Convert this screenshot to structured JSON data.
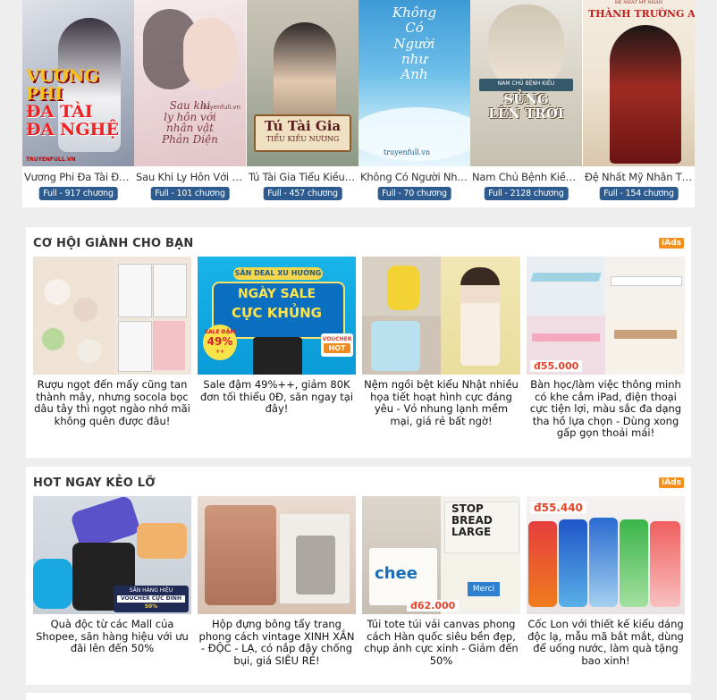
{
  "books": [
    {
      "title": "Vương Phi Đa Tài Đa Nghệ",
      "status": "Full - 917 chương",
      "cover_lines": [
        "VƯƠNG PHI",
        "ĐA TÀI",
        "ĐA NGHỆ"
      ],
      "cover_site": "TRUYENFULL.VN"
    },
    {
      "title": "Sau Khi Ly Hôn Với Nhân Vật Phản Diện",
      "status": "Full - 101 chương",
      "cover_lines": [
        "Sau khi",
        "ly hôn với",
        "nhân vật",
        "Phản Diện"
      ],
      "cover_site": "truyenfull.vn"
    },
    {
      "title": "Tú Tài Gia Tiểu Kiều Nương",
      "status": "Full - 457 chương",
      "cover_lines": [
        "Tú Tài Gia"
      ],
      "cover_sub": "TIỂU KIỀU NƯƠNG"
    },
    {
      "title": "Không Có Người Như Anh",
      "status": "Full - 70 chương",
      "cover_lines": [
        "Không",
        "Có",
        "Người",
        "như",
        "Anh"
      ],
      "cover_site": "truyenfull.vn"
    },
    {
      "title": "Nam Chủ Bệnh Kiều, Sủng Lên Trời",
      "status": "Full - 2128 chương",
      "cover_lines": [
        "SỦNG",
        "LÊN TRỜI"
      ],
      "cover_sub": "NAM CHỦ BỆNH KIỀU"
    },
    {
      "title": "Đệ Nhất Mỹ Nhân Thành Trường An",
      "status": "Full - 154 chương",
      "cover_lines": [
        "THÀNH TRƯỜNG AN"
      ],
      "cover_sub": "ĐỆ NHẤT MỸ NHÂN"
    }
  ],
  "sections": [
    {
      "title": "CƠ HỘI GIÀNH CHO BẠN",
      "badge": "iAds",
      "cards": [
        {
          "caption": "Rượu ngọt đến mấy cũng tan thành mây, nhưng socola bọc dâu tây thì ngọt ngào nhớ mãi không quên được đâu!"
        },
        {
          "caption": "Sale đậm 49%++, giảm 80K đơn tối thiểu 0Đ, săn ngay tại đây!",
          "banner": [
            "SĂN DEAL XU HƯỚNG",
            "NGÀY SALE",
            "CỰC KHỦNG"
          ],
          "sale_badge": [
            "SALE ĐẬM",
            "49%",
            "++"
          ],
          "voucher": [
            "VOUCHER",
            "HOT"
          ]
        },
        {
          "caption": "Nệm ngồi bệt kiểu Nhật nhiều họa tiết hoạt hình cực đáng yêu - Vỏ nhung lạnh mềm mại, giá rẻ bất ngờ!"
        },
        {
          "caption": "Bàn học/làm việc thông minh có khe cắm iPad, điện thoại cực tiện lợi, màu sắc đa dạng tha hồ lựa chọn - Dùng xong gấp gọn thoải mái!",
          "price": "đ55.000"
        }
      ]
    },
    {
      "title": "HOT NGAY KẺO LỠ",
      "badge": "iAds",
      "cards": [
        {
          "caption": "Quà độc từ các Mall của Shopee, săn hàng hiệu với ưu đãi lên đến 50%",
          "voucher": [
            "SĂN HÀNG HIỆU",
            "VOUCHER CỰC ĐỈNH"
          ],
          "deal": "50%"
        },
        {
          "caption": "Hộp đựng bông tẩy trang phong cách vintage XINH XẮN - ĐỘC - LẠ, có nắp đậy chống bụi, giá SIÊU RẺ!"
        },
        {
          "caption": "Túi tote túi vải canvas phong cách Hàn quốc siêu bền đẹp, chụp ảnh cực xinh - Giảm đến 50%",
          "price": "đ62.000",
          "bag_text": [
            "STOP",
            "BREAD",
            "LARGE",
            "Merci",
            "chee"
          ]
        },
        {
          "caption": "Cốc Lon với thiết kế kiểu dáng độc lạ, mẫu mã bắt mắt, dùng để uống nước, làm quà tặng bao xinh!",
          "price": "đ55.440"
        }
      ]
    }
  ]
}
